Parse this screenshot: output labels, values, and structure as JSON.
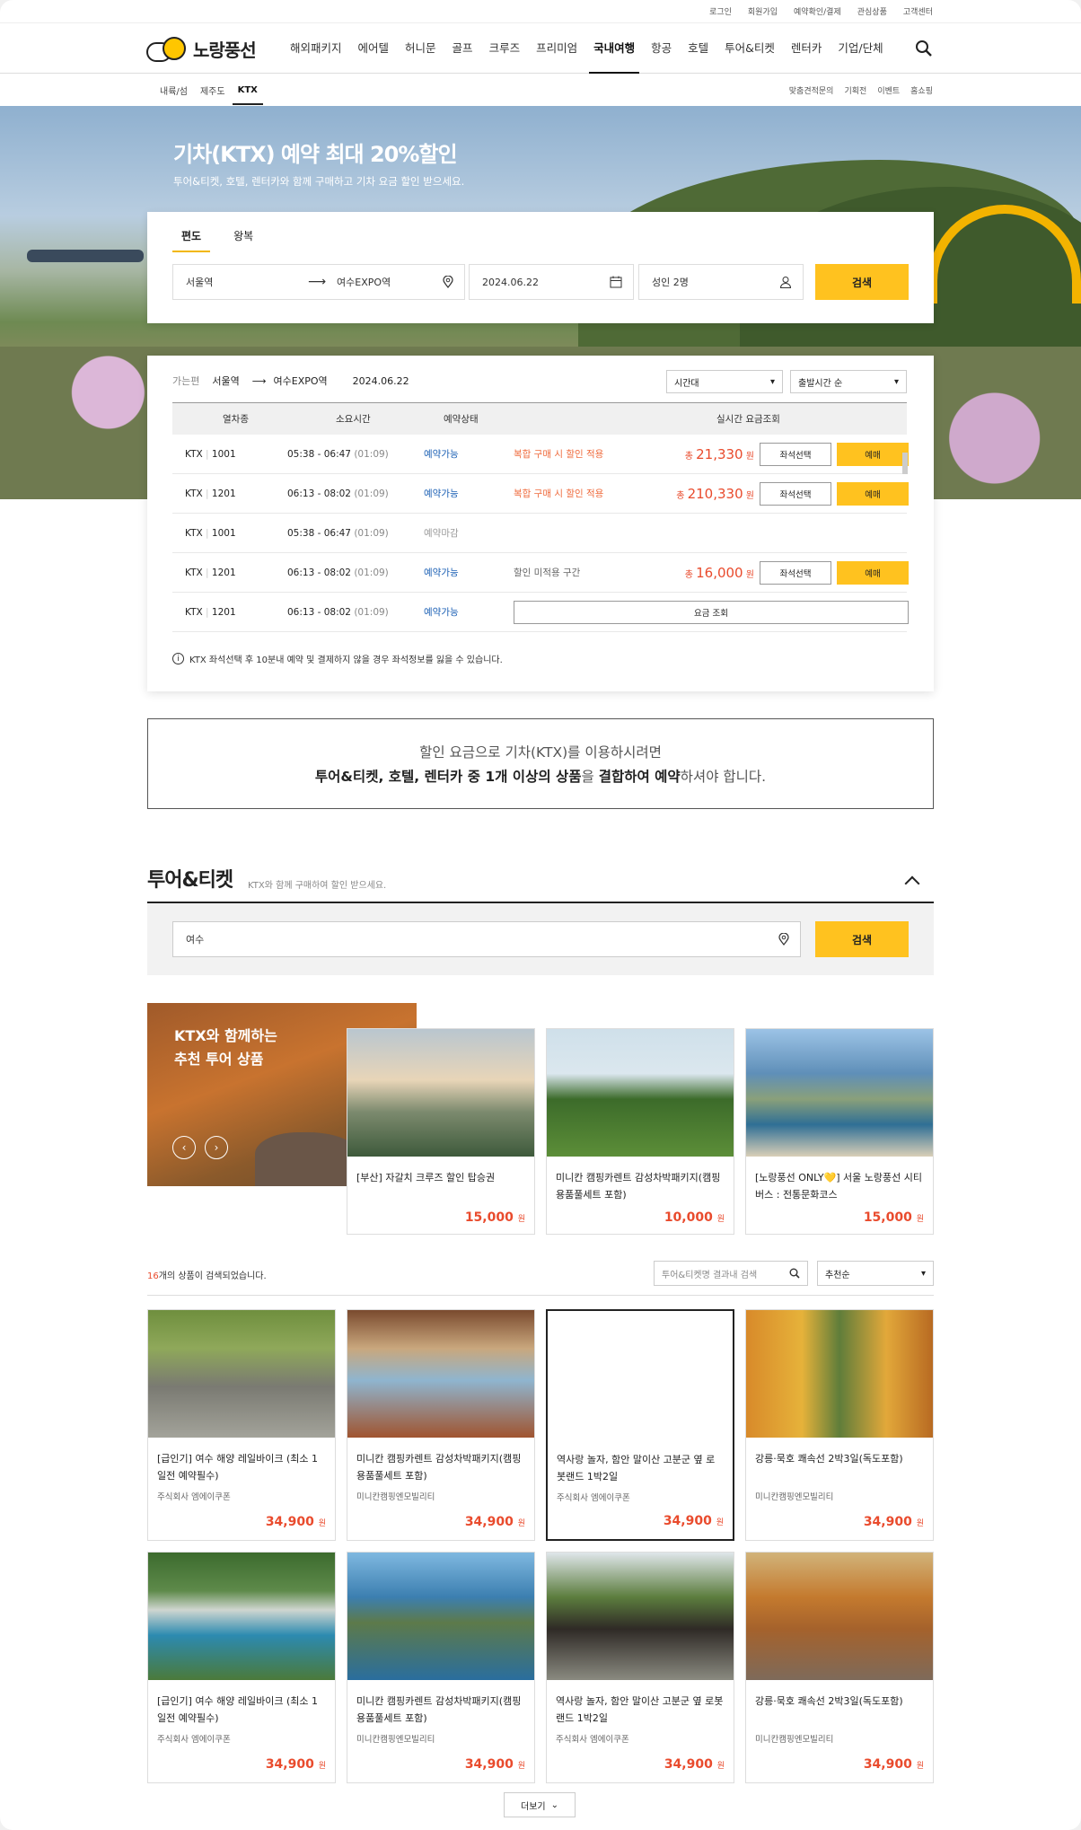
{
  "util": [
    "로그인",
    "회원가입",
    "예약확인/결제",
    "관심상품",
    "고객센터"
  ],
  "logo": {
    "text": "노랑풍선"
  },
  "menu": [
    "해외패키지",
    "에어텔",
    "허니문",
    "골프",
    "크루즈",
    "프리미엄",
    "국내여행",
    "항공",
    "호텔",
    "투어&티켓",
    "렌터카",
    "기업/단체"
  ],
  "lnb_left": [
    "내륙/섬",
    "제주도",
    "KTX"
  ],
  "lnb_right": [
    "맞춤견적문의",
    "기획전",
    "이벤트",
    "홈쇼핑"
  ],
  "hero": {
    "title": "기차(KTX) 예약 최대 20%할인",
    "subtitle": "투어&티켓, 호텔, 렌터카와 함께 구매하고 기차 요금 할인 받으세요."
  },
  "booking": {
    "tab_oneway": "편도",
    "tab_round": "왕복",
    "from": "서울역",
    "to": "여수EXPO역",
    "date": "2024.06.22",
    "pax": "성인 2명",
    "search": "검색"
  },
  "result": {
    "label": "가는편",
    "from": "서울역",
    "to": "여수EXPO역",
    "date": "2024.06.22",
    "sel_time": "시간대",
    "sel_sort": "출발시간 순",
    "headers": [
      "열차종",
      "소요시간",
      "예약상태",
      "실시간 요금조회"
    ],
    "rows": [
      {
        "train": "KTX",
        "no": "1001",
        "time": "05:38 - 06:47",
        "dur": "(01:09)",
        "status": "예약가능",
        "note": "복합 구매 시 할인 적용",
        "price_pre": "총",
        "price": "21,330",
        "unit": "원",
        "seat": "좌석선택",
        "book": "예매"
      },
      {
        "train": "KTX",
        "no": "1201",
        "time": "06:13 - 08:02",
        "dur": "(01:09)",
        "status": "예약가능",
        "note": "복합 구매 시 할인 적용",
        "price_pre": "총",
        "price": "210,330",
        "unit": "원",
        "seat": "좌석선택",
        "book": "예매"
      },
      {
        "train": "KTX",
        "no": "1001",
        "time": "05:38 - 06:47",
        "dur": "(01:09)",
        "status": "예약마감"
      },
      {
        "train": "KTX",
        "no": "1201",
        "time": "06:13 - 08:02",
        "dur": "(01:09)",
        "status": "예약가능",
        "note": "할인 미적용 구간",
        "price_pre": "총",
        "price": "16,000",
        "unit": "원",
        "seat": "좌석선택",
        "book": "예매"
      },
      {
        "train": "KTX",
        "no": "1201",
        "time": "06:13 - 08:02",
        "dur": "(01:09)",
        "status": "예약가능",
        "fare": "요금 조회"
      }
    ],
    "notice": "KTX 좌석선택 후 10분내 예약 및 결제하지 않을 경우 좌석정보를 잃을 수 있습니다."
  },
  "msg": {
    "line1": "할인 요금으로 기차(KTX)를 이용하시려면",
    "b1": "투어&티켓, 호텔, 렌터카 중 1개 이상의 상품",
    "mid": "을 ",
    "b2": "결합하여 예약",
    "tail": "하셔야 합니다."
  },
  "tour": {
    "title": "투어&티켓",
    "sub": "KTX와 함께 구매하여 할인 받으세요.",
    "query": "여수",
    "search": "검색"
  },
  "reco": {
    "title1": "KTX와 함께하는",
    "title2": "추천 투어 상품",
    "cards": [
      {
        "name": "[부산] 자갈치 크루즈 할인 탑승권",
        "price": "15,000",
        "unit": "원"
      },
      {
        "name": "미니칸 캠핑카렌트 감성차박패키지(캠핑용품풀세트 포함)",
        "price": "10,000",
        "unit": "원"
      },
      {
        "name": "[노랑풍선 ONLY💛] 서울 노랑풍선 시티버스 : 전통문화코스",
        "price": "15,000",
        "unit": "원"
      }
    ]
  },
  "list": {
    "count_num": "16",
    "count_text": "개의 상품이 검색되었습니다.",
    "search_ph": "투어&티켓명 결과내 검색",
    "sort": "추천순",
    "more": "더보기",
    "items": [
      {
        "name": "[급인기] 여수 해양 레일바이크 (최소 1일전 예약필수)",
        "company": "주식회사 엠에이쿠폰",
        "price": "34,900",
        "unit": "원"
      },
      {
        "name": "미니칸 캠핑카렌트 감성차박패키지(캠핑용품풀세트 포함)",
        "company": "미니칸캠핑엔모빌리티",
        "price": "34,900",
        "unit": "원"
      },
      {
        "name": "역사랑 놀자, 함안 말이산 고분군 옆 로봇랜드 1박2일",
        "company": "주식회사 엠에이쿠폰",
        "price": "34,900",
        "unit": "원"
      },
      {
        "name": "강릉·묵호 쾌속선 2박3일(독도포함)",
        "company": "미니칸캠핑엔모빌리티",
        "price": "34,900",
        "unit": "원"
      },
      {
        "name": "[급인기] 여수 해양 레일바이크 (최소 1일전 예약필수)",
        "company": "주식회사 엠에이쿠폰",
        "price": "34,900",
        "unit": "원"
      },
      {
        "name": "미니칸 캠핑카렌트 감성차박패키지(캠핑용품풀세트 포함)",
        "company": "미니칸캠핑엔모빌리티",
        "price": "34,900",
        "unit": "원"
      },
      {
        "name": "역사랑 놀자, 함안 말이산 고분군 옆 로봇랜드 1박2일",
        "company": "주식회사 엠에이쿠폰",
        "price": "34,900",
        "unit": "원"
      },
      {
        "name": "강릉·묵호 쾌속선 2박3일(독도포함)",
        "company": "미니칸캠핑엔모빌리티",
        "price": "34,900",
        "unit": "원"
      }
    ]
  }
}
